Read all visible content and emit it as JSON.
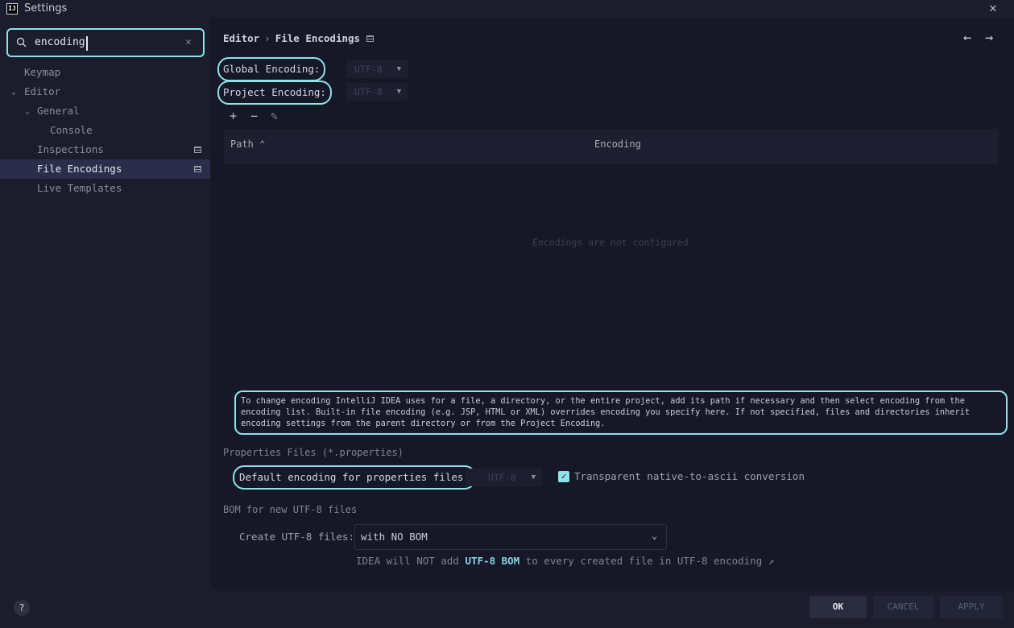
{
  "window": {
    "logo": "IJ",
    "title": "Settings",
    "close": "✕"
  },
  "search": {
    "value": "encoding",
    "clear": "✕"
  },
  "sidebar": {
    "items": [
      {
        "label": "Keymap"
      },
      {
        "label": "Editor"
      },
      {
        "label": "General"
      },
      {
        "label": "Console"
      },
      {
        "label": "Inspections"
      },
      {
        "label": "File Encodings"
      },
      {
        "label": "Live Templates"
      }
    ],
    "help": "?"
  },
  "breadcrumb": {
    "parent": "Editor",
    "separator": "›",
    "current": "File Encodings"
  },
  "nav": {
    "back": "←",
    "forward": "→"
  },
  "global_encoding": {
    "label": "Global Encoding:",
    "value": "UTF-8"
  },
  "project_encoding": {
    "label": "Project Encoding:",
    "value": "UTF-8"
  },
  "toolbar": {
    "add": "+",
    "remove": "−",
    "edit": "✎"
  },
  "table": {
    "columns": [
      "Path",
      "Encoding"
    ],
    "sort_indicator": "⌃",
    "empty_text": "Encodings are not configured"
  },
  "info_text": "To change encoding IntelliJ IDEA uses for a file, a directory, or the entire project, add its path if necessary and then select encoding from the encoding list. Built-in file encoding (e.g. JSP, HTML or XML) overrides encoding you specify here. If not specified, files and directories inherit encoding settings from the parent directory or from the Project Encoding.",
  "properties": {
    "section_title": "Properties Files (*.properties)",
    "default_label": "Default encoding for properties files:",
    "default_value": "UTF-8",
    "transparent_label": "Transparent native-to-ascii conversion",
    "transparent_checked": true,
    "check_glyph": "✓"
  },
  "bom": {
    "section_title": "BOM for new UTF-8 files",
    "create_label": "Create UTF-8 files:",
    "create_value": "with NO BOM",
    "select_arrow": "⌄",
    "hint_prefix": "IDEA will NOT add ",
    "hint_link": "UTF-8 BOM",
    "hint_suffix": " to every created file in UTF-8 encoding ↗"
  },
  "buttons": {
    "ok": "OK",
    "cancel": "CANCEL",
    "apply": "APPLY"
  },
  "colors": {
    "accent": "#8ee3e9",
    "link": "#7fd6e0",
    "background": "#171827",
    "sidebar": "#1b1c2c",
    "selection": "#2b2e4a"
  }
}
